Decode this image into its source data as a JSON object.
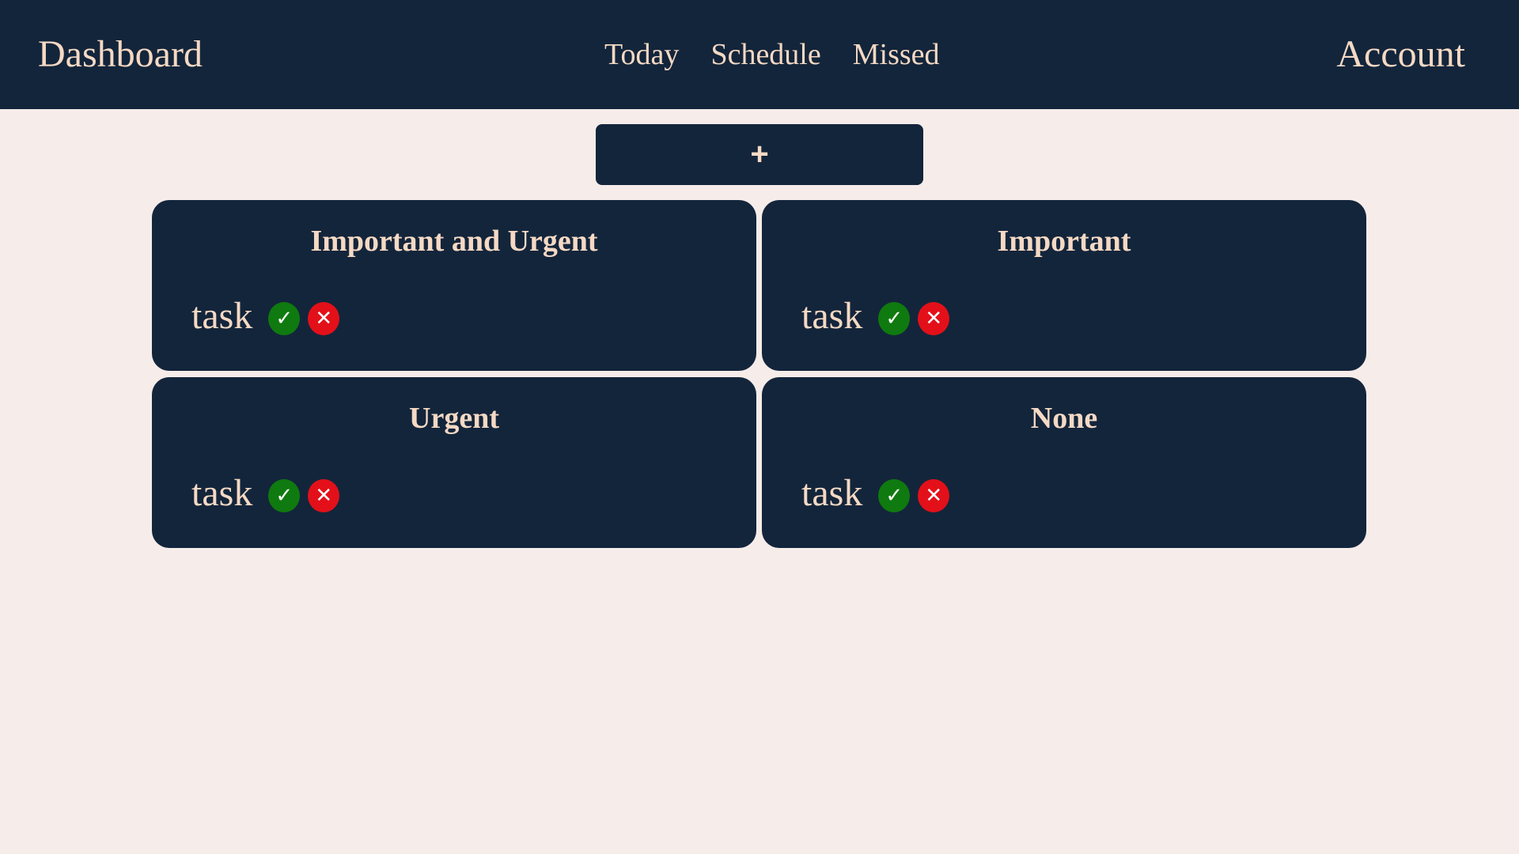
{
  "header": {
    "brand": "Dashboard",
    "nav": [
      {
        "label": "Today"
      },
      {
        "label": "Schedule"
      },
      {
        "label": "Missed"
      }
    ],
    "account": "Account"
  },
  "add_button": {
    "label": "+"
  },
  "quadrants": [
    {
      "title": "Important and Urgent",
      "tasks": [
        {
          "label": "task"
        }
      ]
    },
    {
      "title": "Important",
      "tasks": [
        {
          "label": "task"
        }
      ]
    },
    {
      "title": "Urgent",
      "tasks": [
        {
          "label": "task"
        }
      ]
    },
    {
      "title": "None",
      "tasks": [
        {
          "label": "task"
        }
      ]
    }
  ],
  "icons": {
    "complete": "check-icon",
    "delete": "cross-icon",
    "complete_glyph": "✓",
    "delete_glyph": "✕"
  },
  "colors": {
    "navy": "#13253b",
    "cream_text": "#f5d9c4",
    "background": "#f6ece9",
    "complete_green": "#0f7a0f",
    "delete_red": "#e3101a"
  }
}
